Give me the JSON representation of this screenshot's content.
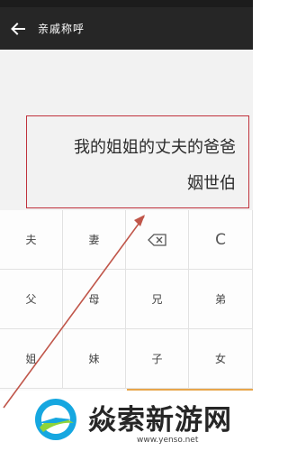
{
  "header": {
    "title": "亲戚称呼",
    "back_icon": "arrow-left-icon"
  },
  "display": {
    "expression": "我的姐姐的丈夫的爸爸",
    "result": "姻世伯",
    "highlight_color": "#c0323c"
  },
  "keypad": {
    "rows": [
      [
        "夫",
        "妻",
        "backspace",
        "C"
      ],
      [
        "父",
        "母",
        "兄",
        "弟"
      ],
      [
        "姐",
        "妹",
        "子",
        "女"
      ]
    ],
    "backspace_icon": "backspace-icon",
    "accent_color": "#e8a64a"
  },
  "watermark": {
    "brand": "焱索新游网",
    "url": "www.yenso.net"
  }
}
